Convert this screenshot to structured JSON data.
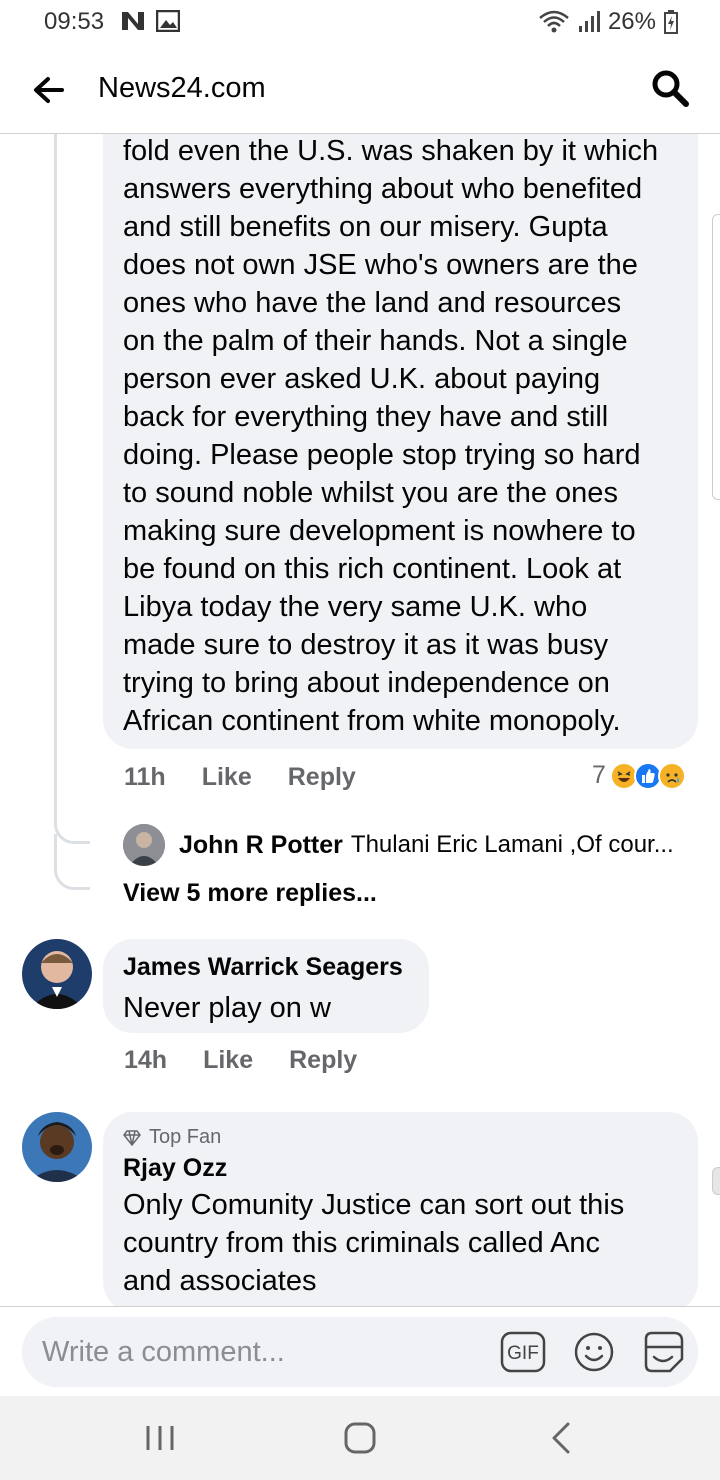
{
  "status": {
    "time": "09:53",
    "battery": "26%"
  },
  "header": {
    "title": "News24.com"
  },
  "comments": {
    "long_comment": {
      "lines": [
        "fold even the U.S. was shaken by it which",
        "answers everything about who benefited",
        "and still benefits on our misery. Gupta",
        "does not own JSE who's owners are the",
        "ones who have the land and resources",
        "on the palm of their hands. Not a single",
        "person ever asked U.K. about paying",
        "back for everything they have and still",
        "doing. Please people stop trying so hard",
        "to sound noble whilst you are the ones",
        "making sure development is nowhere to",
        "be found on this rich continent. Look at",
        "Libya today the very same U.K. who",
        "made sure to destroy it as it was busy",
        "trying to bring about independence on",
        "African continent from white monopoly."
      ],
      "time": "11h",
      "like": "Like",
      "reply": "Reply",
      "reaction_count": "7"
    },
    "reply_preview": {
      "name": "John R Potter",
      "text": "Thulani Eric Lamani ,Of cour..."
    },
    "view_more": "View 5 more replies...",
    "james": {
      "name": "James Warrick Seagers",
      "text": "Never play on w",
      "time": "14h",
      "like": "Like",
      "reply": "Reply"
    },
    "rjay": {
      "badge": "Top Fan",
      "name": "Rjay Ozz",
      "lines": [
        "Only Comunity Justice can sort out this",
        "country from this criminals called Anc",
        "and associates"
      ]
    }
  },
  "composer": {
    "placeholder": "Write a comment...",
    "gif_label": "GIF"
  },
  "colors": {
    "bubble": "#f0f2f5",
    "like_blue": "#1877f2",
    "secondary_text": "#65676b"
  },
  "icons": [
    "back-arrow-icon",
    "search-icon",
    "haha-reaction-icon",
    "like-reaction-icon",
    "sad-reaction-icon",
    "diamond-icon",
    "gif-icon",
    "emoji-icon",
    "sticker-icon"
  ]
}
